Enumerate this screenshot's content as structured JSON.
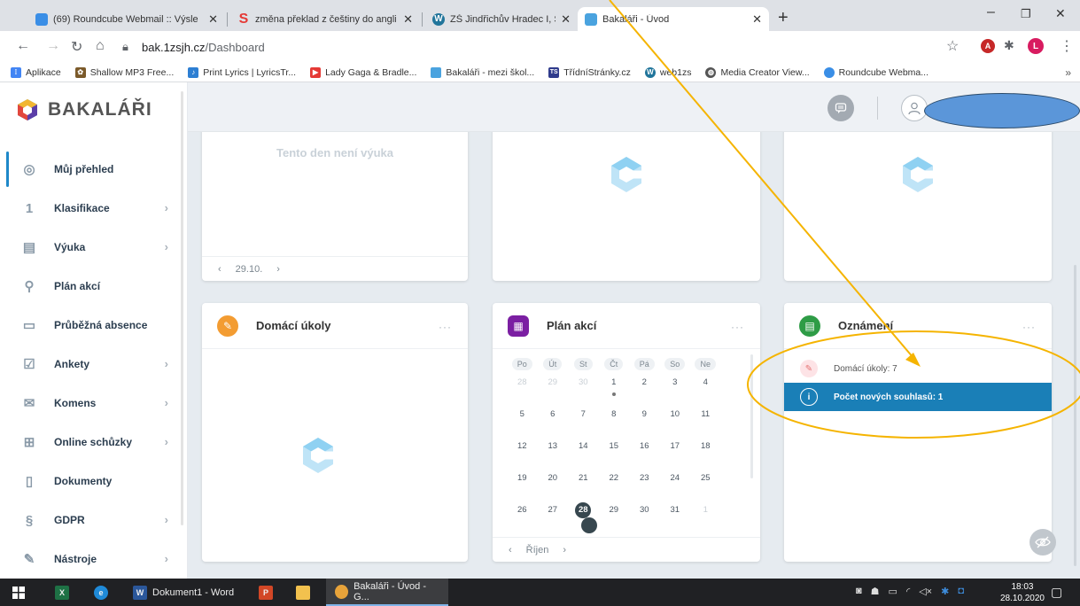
{
  "browser": {
    "tabs": [
      {
        "title": "(69) Roundcube Webmail :: Výsle",
        "favicon_color": "#3a8ee6"
      },
      {
        "title": "změna překlad z češtiny do angli",
        "favicon_color": "#e53935"
      },
      {
        "title": "ZŠ Jindřichův Hradec I, Štítného",
        "favicon_color": "#21759b"
      },
      {
        "title": "Bakaláři - Úvod",
        "favicon_color": "#4aa3df"
      }
    ],
    "url_host": "bak.1zsjh.cz",
    "url_path": "/Dashboard",
    "bookmarks": [
      {
        "label": "Aplikace",
        "icon": "apps-icon",
        "color": "#4285f4"
      },
      {
        "label": "Shallow MP3 Free...",
        "icon": "paw-icon",
        "color": "#7b5a2a"
      },
      {
        "label": "Print Lyrics | LyricsTr...",
        "icon": "lyrics-icon",
        "color": "#2d7fd3"
      },
      {
        "label": "Lady Gaga & Bradle...",
        "icon": "youtube-icon",
        "color": "#e53935"
      },
      {
        "label": "Bakaláři - mezi škol...",
        "icon": "bakalari-icon",
        "color": "#4aa3df"
      },
      {
        "label": "TřídníStránky.cz",
        "icon": "ts-icon",
        "color": "#2f3b8c"
      },
      {
        "label": "web1zs",
        "icon": "wordpress-icon",
        "color": "#21759b"
      },
      {
        "label": "Media Creator View...",
        "icon": "globe-icon",
        "color": "#555555"
      },
      {
        "label": "Roundcube Webma...",
        "icon": "roundcube-icon",
        "color": "#3a8ee6"
      }
    ],
    "bookmarks_more": "»"
  },
  "app": {
    "brand": "BAKALÁŘI",
    "nav": [
      {
        "label": "Můj přehled",
        "icon": "overview-icon",
        "glyph": "◎",
        "chevron": false,
        "active": true
      },
      {
        "label": "Klasifikace",
        "icon": "grades-icon",
        "glyph": "1",
        "chevron": true,
        "active": false
      },
      {
        "label": "Výuka",
        "icon": "teaching-icon",
        "glyph": "▤",
        "chevron": true,
        "active": false
      },
      {
        "label": "Plán akcí",
        "icon": "events-icon",
        "glyph": "⚲",
        "chevron": false,
        "active": false
      },
      {
        "label": "Průběžná absence",
        "icon": "absence-icon",
        "glyph": "▭",
        "chevron": false,
        "active": false
      },
      {
        "label": "Ankety",
        "icon": "polls-icon",
        "glyph": "☑",
        "chevron": true,
        "active": false
      },
      {
        "label": "Komens",
        "icon": "messages-icon",
        "glyph": "✉",
        "chevron": true,
        "active": false
      },
      {
        "label": "Online schůzky",
        "icon": "meetings-icon",
        "glyph": "⊞",
        "chevron": true,
        "active": false
      },
      {
        "label": "Dokumenty",
        "icon": "documents-icon",
        "glyph": "▯",
        "chevron": false,
        "active": false
      },
      {
        "label": "GDPR",
        "icon": "gdpr-icon",
        "glyph": "§",
        "chevron": true,
        "active": false
      },
      {
        "label": "Nástroje",
        "icon": "tools-icon",
        "glyph": "✎",
        "chevron": true,
        "active": false
      }
    ]
  },
  "schedule_card": {
    "no_lesson": "Tento den není výuka",
    "prev": "‹",
    "date": "29.10.",
    "next": "›"
  },
  "homework_card": {
    "title": "Domácí úkoly",
    "more": "···",
    "icon_color": "#f39c32"
  },
  "events_card": {
    "title": "Plán akcí",
    "more": "···",
    "icon_color": "#7b1fa2",
    "weekdays": [
      "Po",
      "Út",
      "St",
      "Čt",
      "Pá",
      "So",
      "Ne"
    ],
    "weeks": [
      [
        {
          "d": "28",
          "dim": true
        },
        {
          "d": "29",
          "dim": true
        },
        {
          "d": "30",
          "dim": true
        },
        {
          "d": "1",
          "dot": "grey"
        },
        {
          "d": "2"
        },
        {
          "d": "3"
        },
        {
          "d": "4"
        }
      ],
      [
        {
          "d": "5"
        },
        {
          "d": "6"
        },
        {
          "d": "7"
        },
        {
          "d": "8"
        },
        {
          "d": "9"
        },
        {
          "d": "10"
        },
        {
          "d": "11"
        }
      ],
      [
        {
          "d": "12"
        },
        {
          "d": "13"
        },
        {
          "d": "14"
        },
        {
          "d": "15"
        },
        {
          "d": "16"
        },
        {
          "d": "17"
        },
        {
          "d": "18"
        }
      ],
      [
        {
          "d": "19"
        },
        {
          "d": "20"
        },
        {
          "d": "21"
        },
        {
          "d": "22"
        },
        {
          "d": "23"
        },
        {
          "d": "24"
        },
        {
          "d": "25"
        }
      ],
      [
        {
          "d": "26"
        },
        {
          "d": "27"
        },
        {
          "d": "28",
          "today": true,
          "dot": "green"
        },
        {
          "d": "29"
        },
        {
          "d": "30"
        },
        {
          "d": "31"
        },
        {
          "d": "1",
          "dim": true
        }
      ]
    ],
    "prev": "‹",
    "month": "Říjen",
    "next": "›"
  },
  "announcements_card": {
    "title": "Oznámení",
    "more": "···",
    "icon_color": "#2e9c46",
    "items": [
      {
        "text": "Domácí úkoly: 7",
        "icon": "homework-icon",
        "selected": false
      },
      {
        "text": "Počet nových souhlasů: 1",
        "icon": "info-icon",
        "selected": true
      }
    ]
  },
  "taskbar": {
    "word_label": "Dokument1 - Word",
    "chrome_label": "Bakaláři - Úvod - G...",
    "time": "18:03",
    "date": "28.10.2020"
  },
  "colors": {
    "accent": "#1a7fb7",
    "annotation": "#f5b400",
    "redaction": "#5b96d9"
  }
}
